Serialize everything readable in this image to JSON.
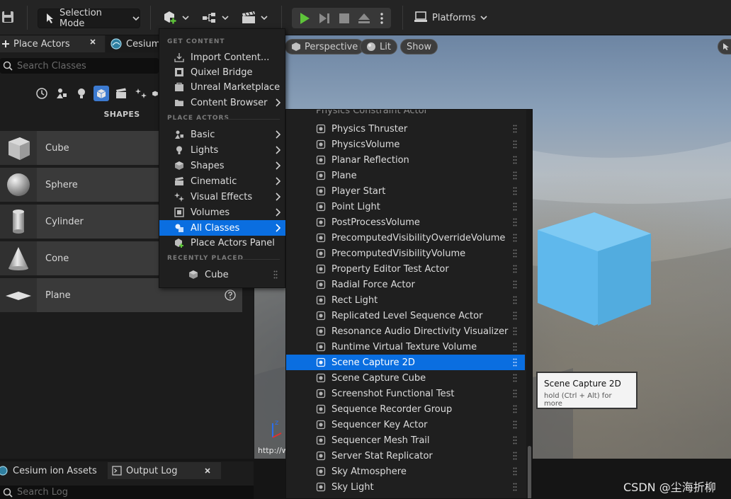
{
  "toolbar": {
    "selection_mode": "Selection Mode",
    "platforms": "Platforms"
  },
  "left_panel": {
    "tab_place_actors": "Place Actors",
    "tab_cesium": "Cesium",
    "search_placeholder": "Search Classes",
    "section_title": "SHAPES",
    "shapes": [
      "Cube",
      "Sphere",
      "Cylinder",
      "Cone",
      "Plane"
    ]
  },
  "viewport": {
    "perspective": "Perspective",
    "lit": "Lit",
    "show": "Show",
    "url_text": "http://w",
    "cube_color": "#5fb8ec"
  },
  "bottom": {
    "tab_cesium_assets": "Cesium ion Assets",
    "tab_output_log": "Output Log",
    "search_log_placeholder": "Search Log"
  },
  "menu": {
    "section_get_content": "GET CONTENT",
    "get_content": [
      "Import Content...",
      "Quixel Bridge",
      "Unreal Marketplace",
      "Content Browser"
    ],
    "section_place_actors": "PLACE ACTORS",
    "place_actors": [
      "Basic",
      "Lights",
      "Shapes",
      "Cinematic",
      "Visual Effects",
      "Volumes",
      "All Classes"
    ],
    "place_actors_panel": "Place Actors Panel",
    "section_recently_placed": "RECENTLY PLACED",
    "recent": [
      "Cube"
    ],
    "selected_item": "All Classes"
  },
  "class_list": {
    "partial_top": "Physics Constraint Actor",
    "items": [
      "Physics Thruster",
      "PhysicsVolume",
      "Planar Reflection",
      "Plane",
      "Player Start",
      "Point Light",
      "PostProcessVolume",
      "PrecomputedVisibilityOverrideVolume",
      "PrecomputedVisibilityVolume",
      "Property Editor Test Actor",
      "Radial Force Actor",
      "Rect Light",
      "Replicated Level Sequence Actor",
      "Resonance Audio Directivity Visualizer",
      "Runtime Virtual Texture Volume",
      "Scene Capture 2D",
      "Scene Capture Cube",
      "Screenshot Functional Test",
      "Sequence Recorder Group",
      "Sequencer Key Actor",
      "Sequencer Mesh Trail",
      "Server Stat Replicator",
      "Sky Atmosphere",
      "Sky Light"
    ],
    "selected_item": "Scene Capture 2D"
  },
  "tooltip": {
    "title": "Scene Capture 2D",
    "hint": "hold (Ctrl + Alt) for more"
  },
  "watermark": "CSDN @尘海折柳",
  "colors": {
    "accent": "#0a6ee0",
    "play": "#5ec43a"
  }
}
